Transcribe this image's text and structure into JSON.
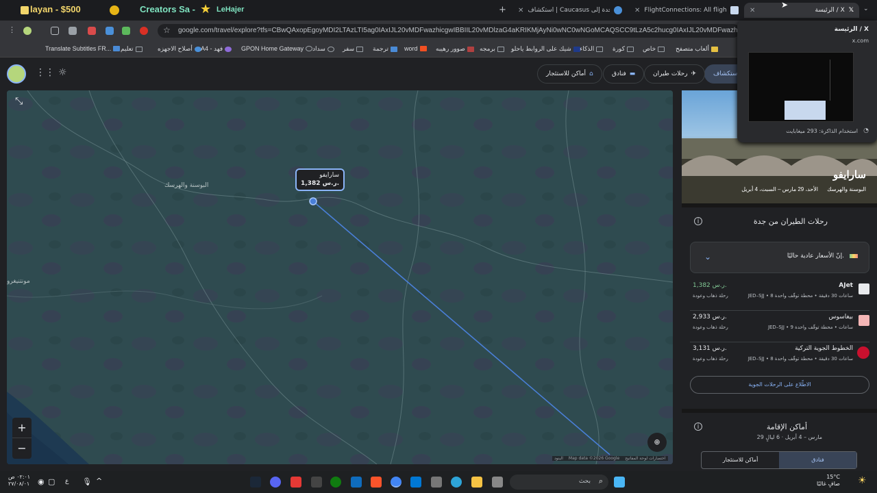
{
  "browser": {
    "left_labels": {
      "layan": "layan - $500",
      "creators": "Creators Sa -",
      "lehajer": "LeHajer"
    },
    "tabs": [
      {
        "label": "استكشاف | Caucasus من جدة إلى",
        "active": false
      },
      {
        "label": "FlightConnections: All flights world",
        "active": false
      },
      {
        "label": "الرئيسة / X",
        "active": true
      }
    ],
    "url": "google.com/travel/explore?tfs=CBwQAxopEgoyMDI2LTAzLTI5ag0IAxIJL20vMDFwazhicgwIBBIIL20vMDlzaG4aKRIKMjAyNi0wNC0wNGoMCAQSCC9tLzA5c2hucg0IAxIJL20vMDFwazhiQAFIA",
    "popup": {
      "title": "الرئيسة / X",
      "domain": "x.com",
      "memory": "استخدام الذاكرة: 293 ميغابايت"
    }
  },
  "bookmarks": [
    "Translate Subtitles FR...",
    "تعليم",
    "أصلاح الاجهزه",
    "A4 - فهد",
    "GPON Home Gateway",
    "سداد",
    "سفر",
    "ترجمة",
    "word",
    "صوور رهيبه",
    "برمجه",
    "شيك على الروابط ياحلو",
    "الذكاء",
    "كورة",
    "خاص",
    "ألعاب متصفح"
  ],
  "appbar": {
    "tabs": [
      {
        "label": "استكشاف",
        "selected": true
      },
      {
        "label": "رحلات طيران",
        "selected": false
      },
      {
        "label": "فنادق",
        "selected": false
      },
      {
        "label": "أماكن للاستئجار",
        "selected": false
      }
    ]
  },
  "map": {
    "pin_city": "سارايفو",
    "pin_price": "1,382 ر.س.",
    "label_bosnia": "البوسنة والهرسك",
    "label_montenegro": "مونتنيغرو",
    "attribution": "Map data ©2026 Google",
    "shortcuts": "اختصارات لوحة المفاتيح",
    "terms": "البنود",
    "zoom_in": "+",
    "zoom_out": "−"
  },
  "panel": {
    "city": "سارايفو",
    "country": "البوسنة والهرسك",
    "dates": "الأحد، 29 مارس – السبت، 4 أبريل",
    "flights_title": "رحلات الطيران من جدة",
    "price_notice": "إنّ الأسعار عادية حاليًا.",
    "flights": [
      {
        "airline": "AJet",
        "price": "1,382 ر.س.",
        "details": "JED–SJJ • 8 ساعات 30 دقيقة • محطة توقّف واحدة",
        "trip": "رحلة ذهاب وعودة",
        "price_color": "#81c995"
      },
      {
        "airline": "بيغاسوس",
        "price": "2,933 ر.س.",
        "details": "JED–SJJ • 9 ساعات • محطة توقّف واحدة",
        "trip": "رحلة ذهاب وعودة",
        "price_color": "#e8eaed"
      },
      {
        "airline": "الخطوط الجوية التركية",
        "price": "3,131 ر.س.",
        "details": "JED–SJJ • 8 ساعات 30 دقيقة • محطة توقّف واحدة",
        "trip": "رحلة ذهاب وعودة",
        "price_color": "#e8eaed"
      }
    ],
    "see_flights": "الاطّلاع على الرحلات الجوية",
    "stays_title": "أماكن الإقامة",
    "stays_dates": "29 مارس – 4 أبريل · 6 ليالٍ",
    "stays_tabs": [
      {
        "label": "فنادق",
        "selected": true
      },
      {
        "label": "أماكن للاستئجار",
        "selected": false
      }
    ]
  },
  "taskbar": {
    "search": "بحث",
    "weather_temp": "15°C",
    "weather_desc": "صافٍ غالبًا",
    "time": "٠٢:٠١ ص",
    "date": "٢٧/٠٨/٠١",
    "lang": "ع"
  },
  "colors": {
    "accent": "#8ab4f8",
    "route": "#4a7fd8",
    "map_bg": "#2e4a4f",
    "price_green": "#81c995"
  }
}
